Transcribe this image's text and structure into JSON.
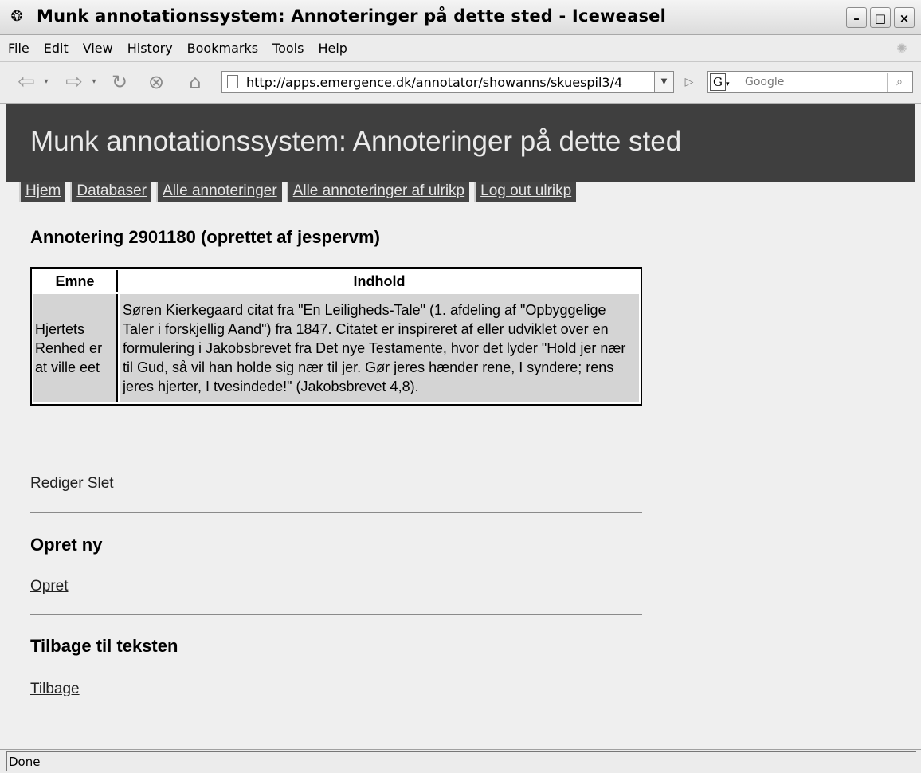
{
  "window": {
    "title": "Munk annotationssystem: Annoteringer på dette sted - Iceweasel",
    "buttons": {
      "minimize": "–",
      "maximize": "□",
      "close": "×"
    }
  },
  "menubar": {
    "items": [
      "File",
      "Edit",
      "View",
      "History",
      "Bookmarks",
      "Tools",
      "Help"
    ]
  },
  "toolbar": {
    "url": "http://apps.emergence.dk/annotator/showanns/skuespil3/4",
    "search_placeholder": "Google",
    "search_engine_icon": "google-icon"
  },
  "page": {
    "banner_title": "Munk annotationssystem: Annoteringer på dette sted",
    "tabs": [
      "Hjem",
      "Databaser",
      "Alle annoteringer",
      "Alle annoteringer af ulrikp",
      "Log out ulrikp"
    ],
    "annotation_heading": "Annotering 2901180 (oprettet af jespervm)",
    "table": {
      "headers": [
        "Emne",
        "Indhold"
      ],
      "subject": "Hjertets Renhed er at ville eet",
      "content": "Søren Kierkegaard citat fra \"En Leiligheds-Tale\" (1. afdeling af \"Opbyggelige Taler i forskjellig Aand\") fra 1847. Citatet er inspireret af eller udviklet over en formulering i Jakobsbrevet fra Det nye Testamente, hvor det lyder \"Hold jer nær til Gud, så vil han holde sig nær til jer. Gør jeres hænder rene, I syndere; rens jeres hjerter, I tvesindede!\" (Jakobsbrevet 4,8)."
    },
    "edit_link": "Rediger",
    "delete_link": "Slet",
    "create_heading": "Opret ny",
    "create_link": "Opret",
    "back_heading": "Tilbage til teksten",
    "back_link": "Tilbage"
  },
  "status": {
    "text": "Done"
  }
}
